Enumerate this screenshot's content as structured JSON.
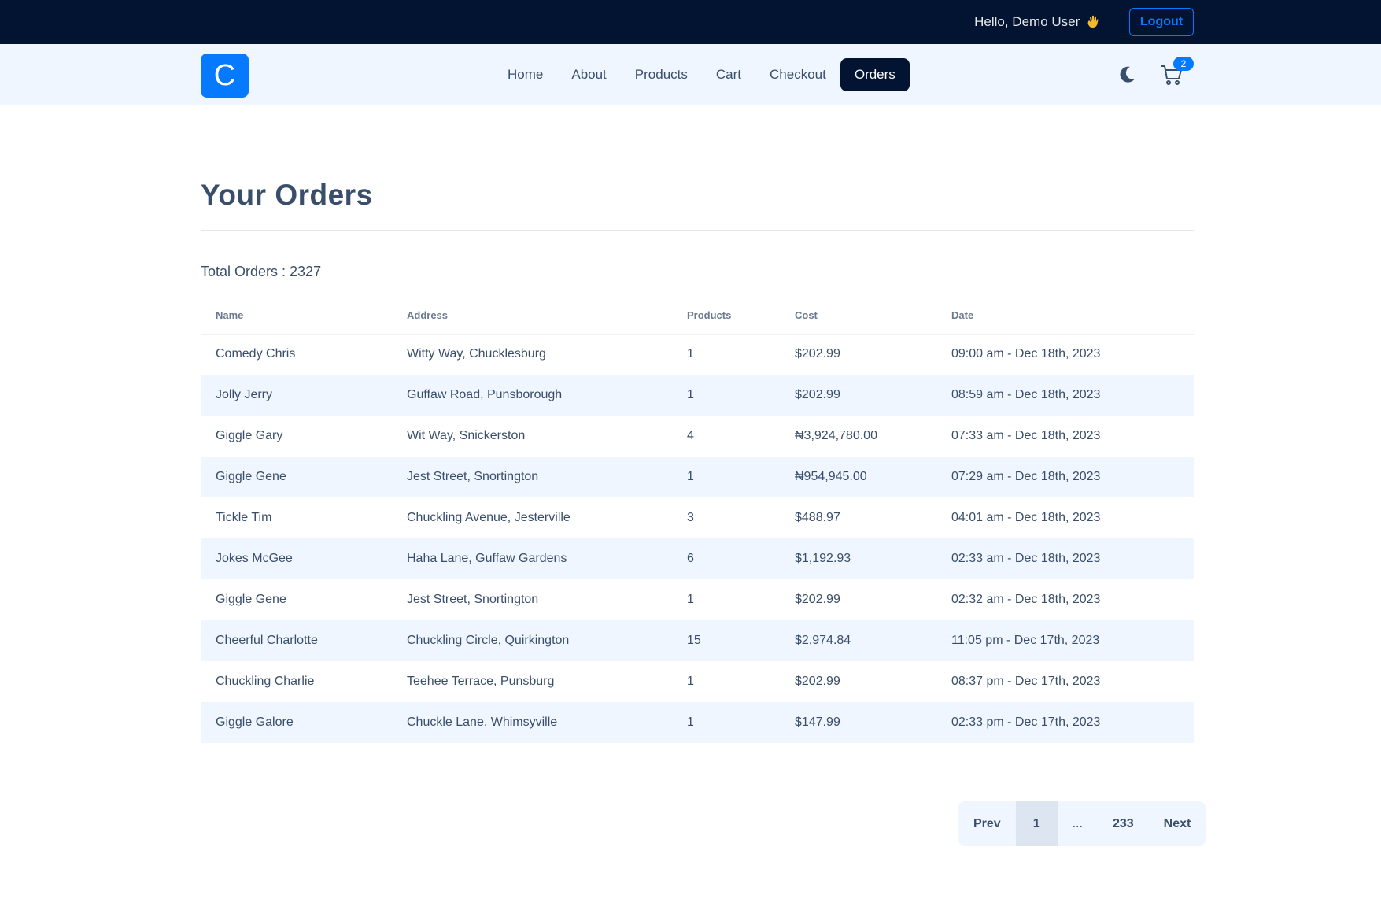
{
  "topbar": {
    "greeting": "Hello, Demo User",
    "logout_label": "Logout"
  },
  "navbar": {
    "logo_letter": "C",
    "links": [
      {
        "label": "Home"
      },
      {
        "label": "About"
      },
      {
        "label": "Products"
      },
      {
        "label": "Cart"
      },
      {
        "label": "Checkout"
      },
      {
        "label": "Orders",
        "active": true
      }
    ],
    "cart_count": "2",
    "theme_icon": "moon-icon",
    "cart_icon": "cart-icon"
  },
  "page": {
    "title": "Your Orders",
    "total_orders_label": "Total Orders : 2327"
  },
  "table": {
    "columns": [
      "Name",
      "Address",
      "Products",
      "Cost",
      "Date"
    ],
    "rows": [
      {
        "name": "Comedy Chris",
        "address": "Witty Way, Chucklesburg",
        "products": "1",
        "cost": "$202.99",
        "date": "09:00 am - Dec 18th, 2023"
      },
      {
        "name": "Jolly Jerry",
        "address": "Guffaw Road, Punsborough",
        "products": "1",
        "cost": "$202.99",
        "date": "08:59 am - Dec 18th, 2023"
      },
      {
        "name": "Giggle Gary",
        "address": "Wit Way, Snickerston",
        "products": "4",
        "cost": "₦3,924,780.00",
        "date": "07:33 am - Dec 18th, 2023"
      },
      {
        "name": "Giggle Gene",
        "address": "Jest Street, Snortington",
        "products": "1",
        "cost": "₦954,945.00",
        "date": "07:29 am - Dec 18th, 2023"
      },
      {
        "name": "Tickle Tim",
        "address": "Chuckling Avenue, Jesterville",
        "products": "3",
        "cost": "$488.97",
        "date": "04:01 am - Dec 18th, 2023"
      },
      {
        "name": "Jokes McGee",
        "address": "Haha Lane, Guffaw Gardens",
        "products": "6",
        "cost": "$1,192.93",
        "date": "02:33 am - Dec 18th, 2023"
      },
      {
        "name": "Giggle Gene",
        "address": "Jest Street, Snortington",
        "products": "1",
        "cost": "$202.99",
        "date": "02:32 am - Dec 18th, 2023"
      },
      {
        "name": "Cheerful Charlotte",
        "address": "Chuckling Circle, Quirkington",
        "products": "15",
        "cost": "$2,974.84",
        "date": "11:05 pm - Dec 17th, 2023"
      },
      {
        "name": "Chuckling Charlie",
        "address": "Teehee Terrace, Punsburg",
        "products": "1",
        "cost": "$202.99",
        "date": "08:37 pm - Dec 17th, 2023"
      },
      {
        "name": "Giggle Galore",
        "address": "Chuckle Lane, Whimsyville",
        "products": "1",
        "cost": "$147.99",
        "date": "02:33 pm - Dec 17th, 2023"
      }
    ]
  },
  "pagination": {
    "prev_label": "Prev",
    "current_page": "1",
    "ellipsis": "...",
    "last_page": "233",
    "next_label": "Next"
  },
  "colors": {
    "topbar_bg": "#021431",
    "navbar_bg": "#f0f6ff",
    "accent": "#057aff",
    "text": "#394e6a"
  }
}
